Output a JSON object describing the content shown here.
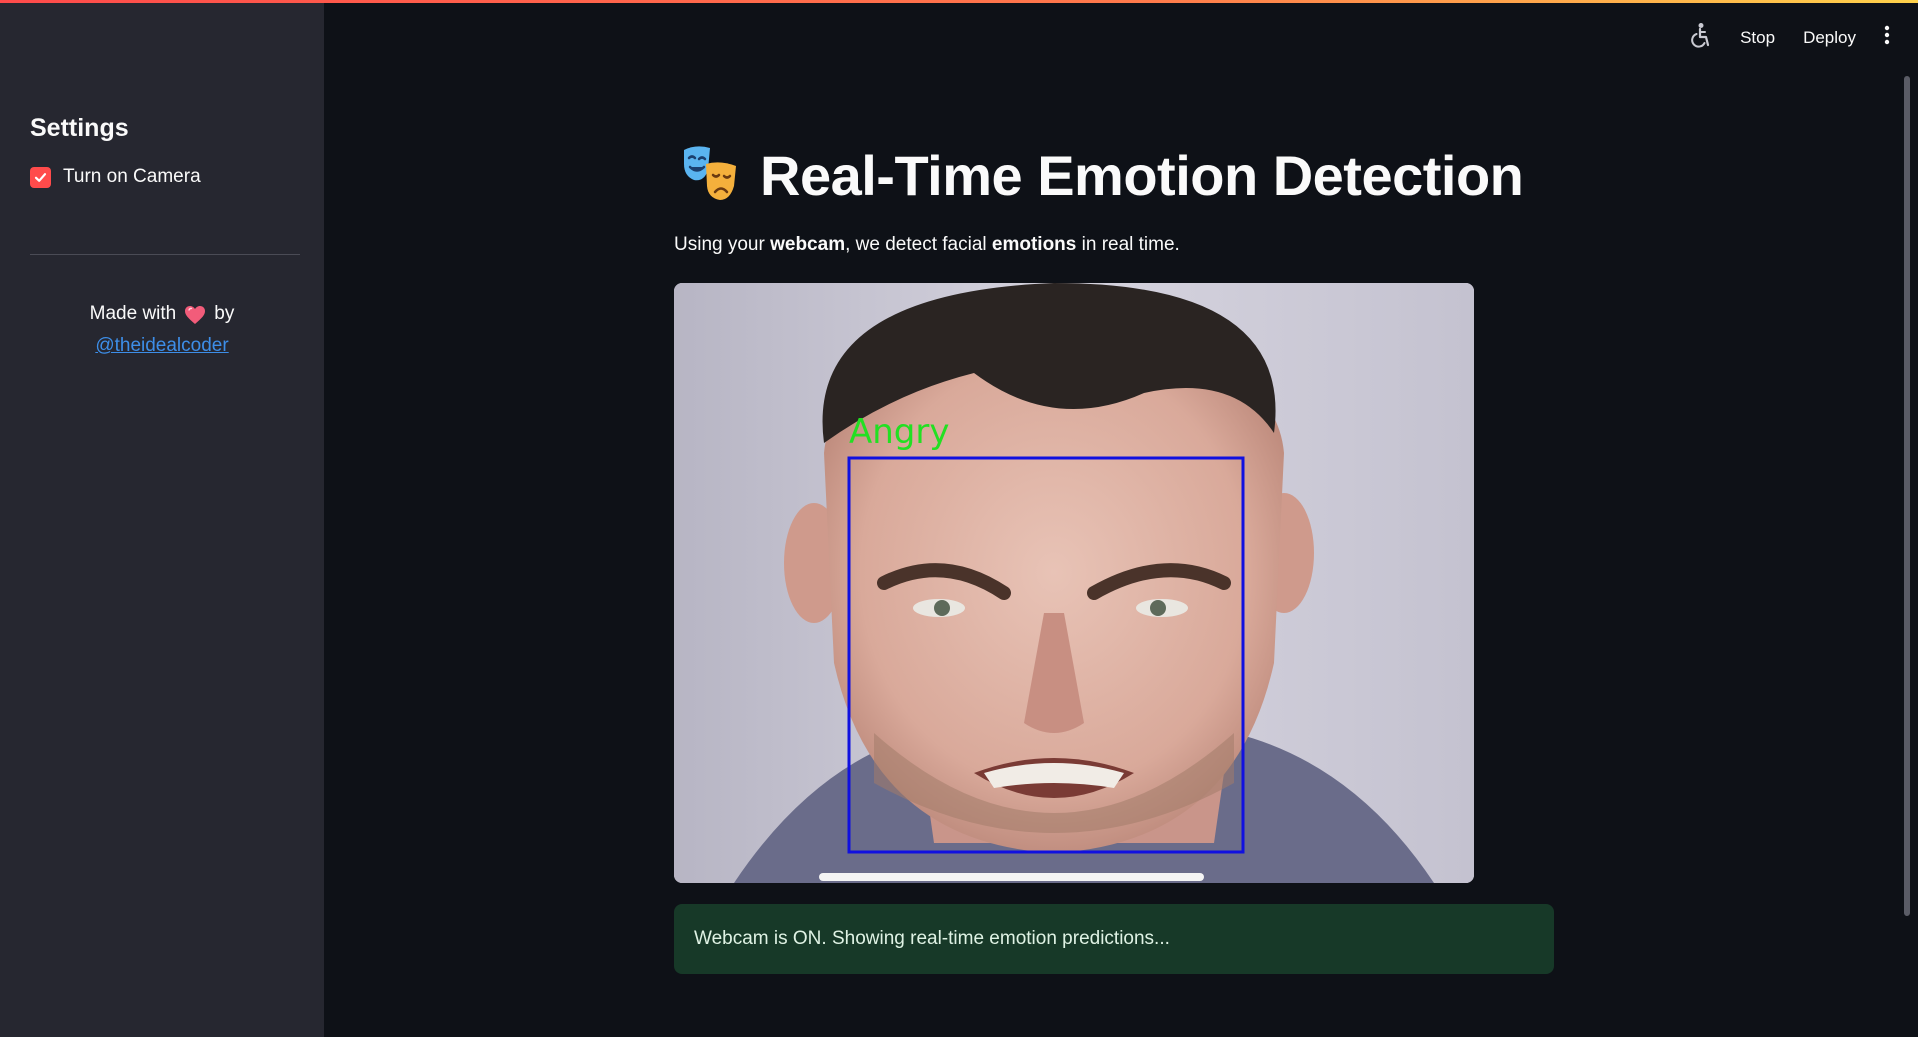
{
  "sidebar": {
    "heading": "Settings",
    "camera_checkbox": {
      "label": "Turn on Camera",
      "checked": true
    },
    "footer": {
      "made_with": "Made with",
      "by": "by",
      "author_link": "@theidealcoder"
    }
  },
  "toolbar": {
    "stop_label": "Stop",
    "deploy_label": "Deploy"
  },
  "main": {
    "title": "Real-Time Emotion Detection",
    "subtitle_parts": {
      "p1": "Using your ",
      "b1": "webcam",
      "p2": ", we detect facial ",
      "b2": "emotions",
      "p3": " in real time."
    },
    "webcam": {
      "detected_emotion": "Angry"
    },
    "status_message": "Webcam is ON. Showing real-time emotion predictions..."
  },
  "colors": {
    "accent": "#ff4b4b",
    "sidebar_bg": "#262730",
    "main_bg": "#0e1117",
    "link": "#3d8ee8",
    "success_bg": "#173928",
    "face_box": "#1010e0",
    "emotion_label": "#22e022"
  },
  "icons": [
    "checkmark-icon",
    "heart-icon",
    "accessibility-icon",
    "kebab-menu-icon",
    "theater-masks-icon"
  ]
}
